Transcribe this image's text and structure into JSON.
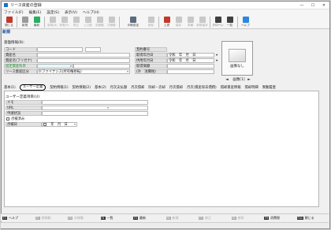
{
  "window": {
    "title": "リース資産の登録"
  },
  "menu": [
    "ファイル(F)",
    "編集(E)",
    "設定(S)",
    "表示(V)",
    "ヘルプ(H)"
  ],
  "toolbar": [
    {
      "label": "閉じる",
      "icon": "close-door-icon",
      "color": "#c0392b",
      "enabled": true
    },
    {
      "label": "新規",
      "icon": "new-doc-icon",
      "color": "#9a9a9a",
      "enabled": true
    },
    {
      "label": "最新",
      "icon": "refresh-icon",
      "color": "#27ae60",
      "enabled": true
    },
    {
      "label": "新規(N)",
      "icon": "new-icon",
      "color": "#c8c8c8",
      "enabled": false
    },
    {
      "label": "参照(R)",
      "icon": "view-icon",
      "color": "#c8c8c8",
      "enabled": false
    },
    {
      "label": "修正",
      "icon": "edit-icon",
      "color": "#c8c8c8",
      "enabled": false
    },
    {
      "label": "入力統",
      "icon": "input-icon",
      "color": "#c8c8c8",
      "enabled": false
    },
    {
      "label": "前移動",
      "icon": "prev-icon",
      "color": "#c8c8c8",
      "enabled": false
    },
    {
      "label": "次移動",
      "icon": "next-icon",
      "color": "#c8c8c8",
      "enabled": false
    },
    {
      "label": "印刷設定",
      "icon": "print-settings-icon",
      "color": "#5d6d7e",
      "enabled": true
    },
    {
      "label": "削除",
      "icon": "delete-icon",
      "color": "#c8c8c8",
      "enabled": false
    },
    {
      "label": "上書",
      "icon": "overwrite-icon",
      "color": "#c0392b",
      "enabled": true
    },
    {
      "label": "保存",
      "icon": "save-icon",
      "color": "#c8c8c8",
      "enabled": false
    },
    {
      "label": "準備",
      "icon": "prepare-icon",
      "color": "#c8c8c8",
      "enabled": false
    },
    {
      "label": "新規保存",
      "icon": "save-new-icon",
      "color": "#c8c8c8",
      "enabled": false
    },
    {
      "label": "クローン",
      "icon": "clone-icon",
      "color": "#3f3f3f",
      "enabled": true
    },
    {
      "label": "一覧",
      "icon": "list-icon",
      "color": "#3f3f3f",
      "enabled": true
    },
    {
      "label": "ヘルプ",
      "icon": "help-icon",
      "color": "#2e86de",
      "enabled": true
    }
  ],
  "mode": "新規",
  "basic": {
    "section_label": "基盤情報(B):",
    "code_label": "コード",
    "name_label": "資産名",
    "kana_label": "資産名(フリガナ)",
    "kind_label": "固定資産科目",
    "kind_value": "",
    "cat_label": "リース資産区分",
    "cat_value": "0:ファイナンス(所有権移転)"
  },
  "contract": {
    "no_label": "契約番号",
    "acq_label": "取得年月日",
    "acq_value": "令和　年　月　日",
    "start_label": "供用年月日",
    "start_value": "令和　年　月　日",
    "price_label": "取得価額",
    "tax_label": "(外　消費税)"
  },
  "photo": {
    "text": "画像なし",
    "label": "画像[1]",
    "prev": "◄",
    "next": "►"
  },
  "tabs": [
    "基本(1)",
    "ユーザー定義",
    "契約情報(1)",
    "契約情報(2)",
    "基本(2)",
    "月次支払額",
    "月次償却",
    "除却・売却",
    "月次償却",
    "月次(資産除去債務)",
    "償却資産情報",
    "償却明細",
    "異動履歴"
  ],
  "active_tab": 1,
  "user_def": {
    "title": "ユーザー定義項目(U):",
    "memo_label": "メモ",
    "url_label": "URL",
    "apply_label": "申請状況",
    "check_label": "点検済み",
    "date_label": "点検日",
    "date_value": "　年　月　日"
  },
  "fkeys": [
    {
      "key": "F1",
      "label": "ヘルプ",
      "enabled": true
    },
    {
      "key": "F2",
      "label": "前移動",
      "enabled": false
    },
    {
      "key": "F3",
      "label": "次移動",
      "enabled": false
    },
    {
      "key": "F4",
      "label": "一覧",
      "enabled": true
    },
    {
      "key": "F5",
      "label": "最新",
      "enabled": true
    },
    {
      "key": "F6",
      "label": "新規",
      "enabled": false
    },
    {
      "key": "F7",
      "label": "修正",
      "enabled": false
    },
    {
      "key": "F8",
      "label": "参照",
      "enabled": false
    },
    {
      "key": "F9",
      "label": "消費税",
      "enabled": true
    },
    {
      "key": "F10",
      "label": "閉じる",
      "enabled": true
    }
  ]
}
